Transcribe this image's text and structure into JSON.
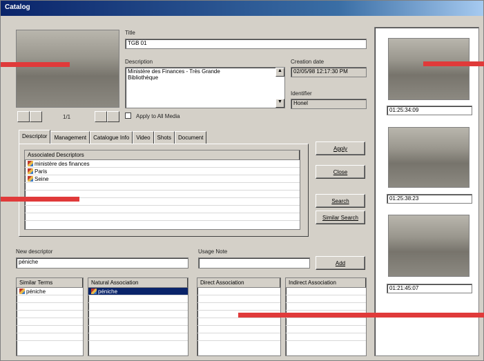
{
  "window": {
    "title": "Catalog"
  },
  "media": {
    "counter": "1/1",
    "apply_all_label": "Apply to All Media"
  },
  "fields": {
    "title_label": "Title",
    "title_value": "TGB 01",
    "description_label": "Description",
    "description_value": "Ministère des Finances - Très Grande Bibliothèque",
    "creation_date_label": "Creation date",
    "creation_date_value": "02/05/98 12:17:30 PM",
    "identifier_label": "Identifier",
    "identifier_value": "Honel"
  },
  "tabs": [
    {
      "label": "Descriptor"
    },
    {
      "label": "Management"
    },
    {
      "label": "Catalogue Info"
    },
    {
      "label": "Video"
    },
    {
      "label": "Shots"
    },
    {
      "label": "Document"
    }
  ],
  "associated": {
    "header": "Associated Descriptors",
    "items": [
      "ministère des finances",
      "Paris",
      "Seine"
    ]
  },
  "buttons": {
    "apply": "Apply",
    "close": "Close",
    "search": "Search",
    "similar_search": "Similar Search",
    "add": "Add"
  },
  "new_descriptor": {
    "label": "New descriptor",
    "value": "péniche"
  },
  "usage_note": {
    "label": "Usage Note",
    "value": ""
  },
  "lists": {
    "similar_terms": {
      "header": "Similar Terms",
      "items": [
        "péniche"
      ]
    },
    "natural_association": {
      "header": "Natural Association",
      "items": [
        "péniche"
      ]
    },
    "direct_association": {
      "header": "Direct Association",
      "items": []
    },
    "indirect_association": {
      "header": "Indirect Association",
      "items": []
    }
  },
  "keyframes": [
    {
      "timecode": "01:25:34:09"
    },
    {
      "timecode": "01:25:38:23"
    },
    {
      "timecode": "01:21:45:07"
    }
  ],
  "colors": {
    "titlebar": "#0a246a",
    "selection": "#0a246a",
    "annotation": "#e03a3a"
  }
}
